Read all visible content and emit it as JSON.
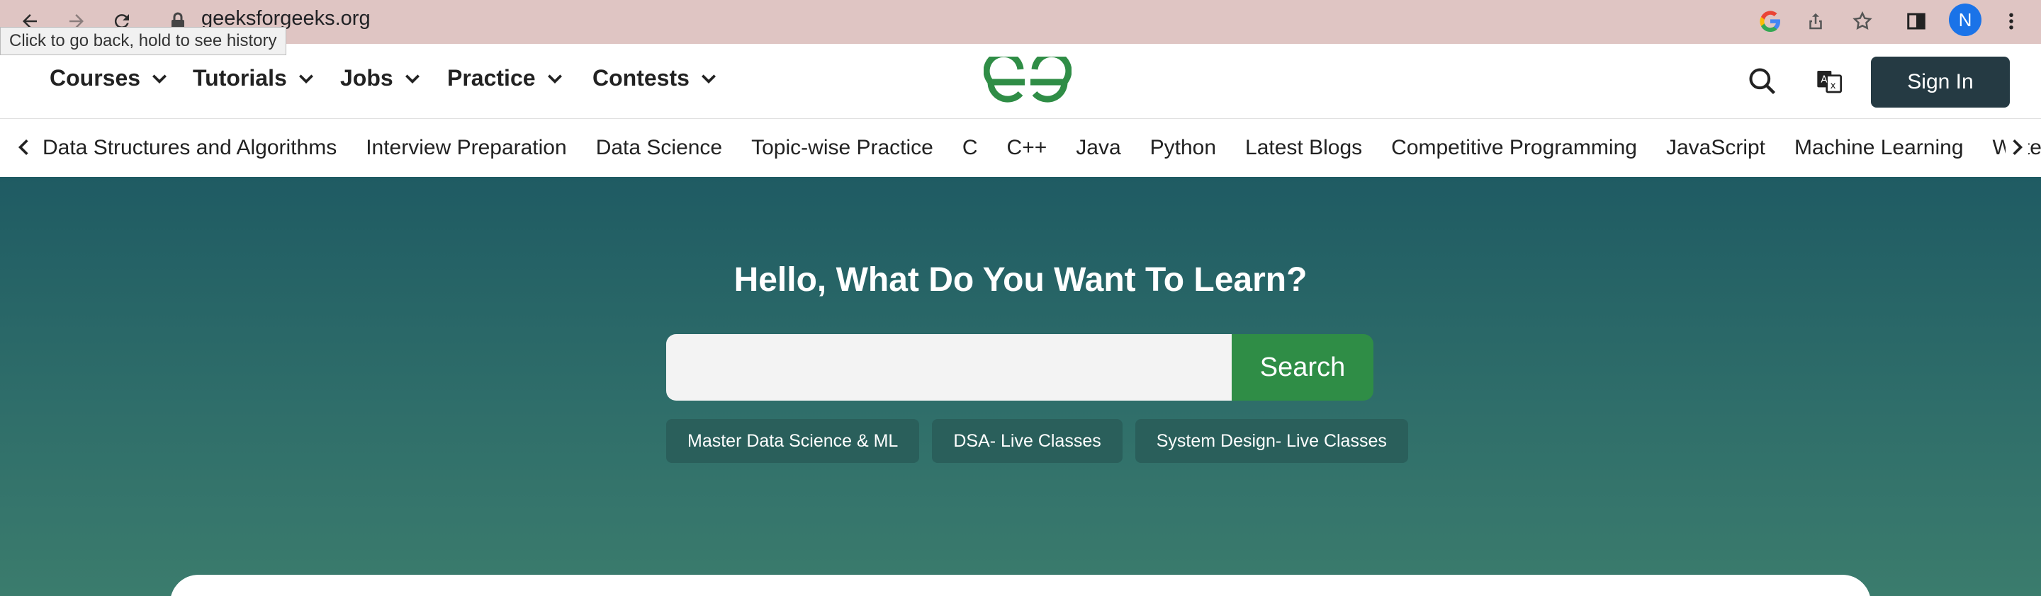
{
  "browser": {
    "url": "geeksforgeeks.org",
    "tooltip": "Click to go back, hold to see history",
    "avatar_letter": "N"
  },
  "header": {
    "menu": [
      {
        "label": "Courses"
      },
      {
        "label": "Tutorials"
      },
      {
        "label": "Jobs"
      },
      {
        "label": "Practice"
      },
      {
        "label": "Contests"
      }
    ],
    "sign_in_label": "Sign In",
    "brand_color": "#2f8d46"
  },
  "categories": [
    "Data Structures and Algorithms",
    "Interview Preparation",
    "Data Science",
    "Topic-wise Practice",
    "C",
    "C++",
    "Java",
    "Python",
    "Latest Blogs",
    "Competitive Programming",
    "JavaScript",
    "Machine Learning",
    "Write"
  ],
  "hero": {
    "title": "Hello, What Do You Want To Learn?",
    "search_placeholder": "",
    "search_button": "Search",
    "chips": [
      "Master Data Science & ML",
      "DSA- Live Classes",
      "System Design- Live Classes"
    ]
  }
}
